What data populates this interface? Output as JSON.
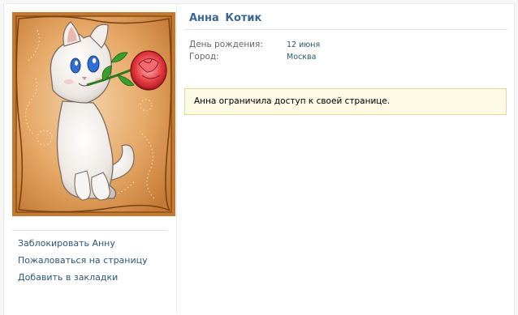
{
  "profile": {
    "name": "Анна  Котик",
    "avatar_icon": "cat-with-rose-avatar"
  },
  "info": {
    "birthday_label": "День рождения:",
    "birthday_value": "12 июня",
    "city_label": "Город:",
    "city_value": "Москва"
  },
  "notice": {
    "text": "Анна ограничила доступ к своей странице."
  },
  "actions": [
    {
      "label": "Заблокировать Анну"
    },
    {
      "label": "Пожаловаться на страницу"
    },
    {
      "label": "Добавить в закладки"
    }
  ],
  "colors": {
    "link": "#2b587a",
    "name": "#3b6798",
    "notice_bg": "#fcf9e4",
    "notice_border": "#e5d98e"
  }
}
